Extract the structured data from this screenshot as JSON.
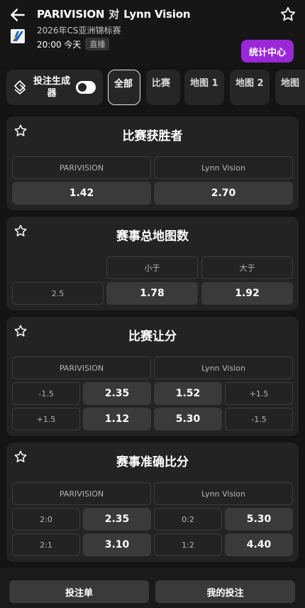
{
  "header": {
    "team_home": "PARIVISION",
    "vs": "对",
    "team_away": "Lynn Vision",
    "subtitle": "2026年CS亚洲锦标赛",
    "time": "20:00 今天",
    "live": "直播",
    "stats_button": "统计中心"
  },
  "tabs": {
    "builder_label": "投注生成器",
    "items": [
      "全部",
      "比赛",
      "地图 1",
      "地图 2",
      "地图"
    ]
  },
  "match_winner": {
    "title": "比赛获胜者",
    "home": "PARIVISION",
    "away": "Lynn Vision",
    "home_odds": "1.42",
    "away_odds": "2.70"
  },
  "total_maps": {
    "title": "赛事总地图数",
    "under": "小于",
    "over": "大于",
    "line": "2.5",
    "under_odds": "1.78",
    "over_odds": "1.92"
  },
  "handicap": {
    "title": "比赛让分",
    "home": "PARIVISION",
    "away": "Lynn Vision",
    "rows": [
      {
        "home_line": "-1.5",
        "home_odds": "2.35",
        "away_odds": "1.52",
        "away_line": "+1.5"
      },
      {
        "home_line": "+1.5",
        "home_odds": "1.12",
        "away_odds": "5.30",
        "away_line": "-1.5"
      }
    ]
  },
  "correct_score": {
    "title": "赛事准确比分",
    "home": "PARIVISION",
    "away": "Lynn Vision",
    "rows": [
      {
        "home_score": "2:0",
        "home_odds": "2.35",
        "away_score": "0:2",
        "away_odds": "5.30"
      },
      {
        "home_score": "2:1",
        "home_odds": "3.10",
        "away_score": "1:2",
        "away_odds": "4.40"
      }
    ]
  },
  "bottom": {
    "betslip": "投注单",
    "my_bets": "我的投注"
  },
  "colors": {
    "accent": "#9a27d8",
    "background": "#141414",
    "card": "#232323",
    "odds_cell": "#3a3a3a"
  },
  "icons": [
    "back-arrow-icon",
    "star-icon",
    "tournament-logo-icon",
    "bet-builder-icon"
  ]
}
